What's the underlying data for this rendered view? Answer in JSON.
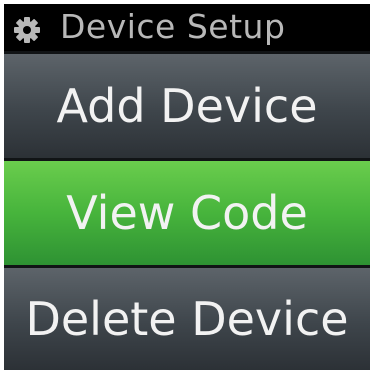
{
  "header": {
    "title": "Device Setup",
    "icon": "gear-icon"
  },
  "menu": {
    "items": [
      {
        "label": "Add Device",
        "selected": false
      },
      {
        "label": "View Code",
        "selected": true
      },
      {
        "label": "Delete Device",
        "selected": false
      }
    ]
  },
  "colors": {
    "header_bg": "#000000",
    "header_text": "#b8b8b8",
    "item_normal": "#3e454b",
    "item_selected": "#47b43c",
    "item_text": "#f2f2f2"
  }
}
